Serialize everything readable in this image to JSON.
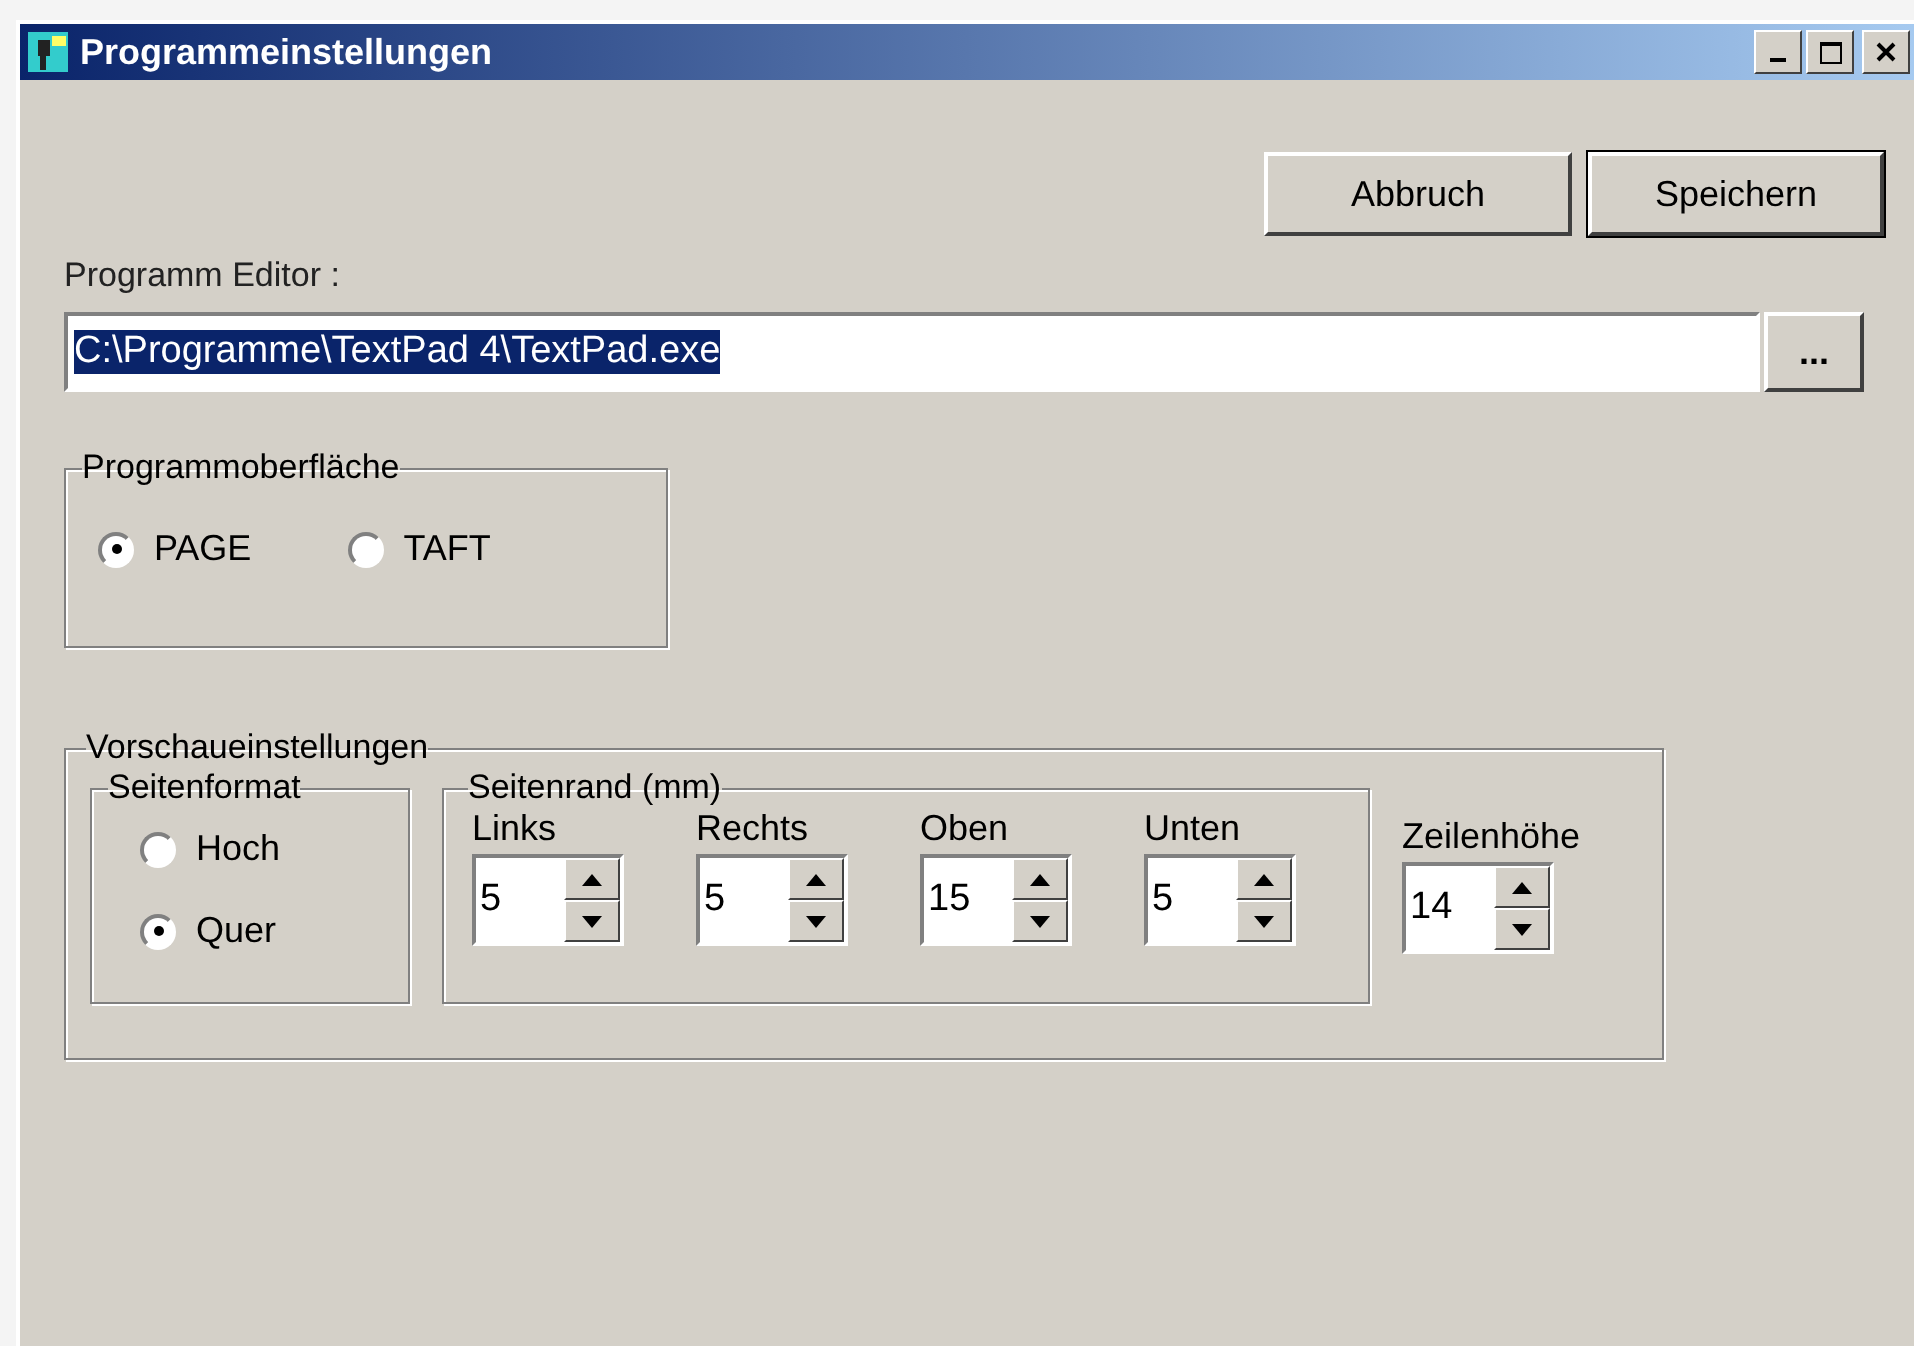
{
  "window": {
    "title": "Programmeinstellungen"
  },
  "buttons": [
    {
      "label": "Abbruch",
      "default": false
    },
    {
      "label": "Speichern",
      "default": true
    }
  ],
  "editor": {
    "label": "Programm Editor :",
    "value": "C:\\Programme\\TextPad 4\\TextPad.exe",
    "highlighted": true,
    "browse": "..."
  },
  "interface_group": {
    "title": "Programmoberfläche",
    "options": [
      {
        "label": "PAGE",
        "selected": true
      },
      {
        "label": "TAFT",
        "selected": false
      }
    ]
  },
  "preview_group": {
    "title": "Vorschaueinstellungen",
    "page_format": {
      "title": "Seitenformat",
      "options": [
        {
          "label": "Hoch",
          "selected": false
        },
        {
          "label": "Quer",
          "selected": true
        }
      ]
    },
    "margins": {
      "title": "Seitenrand (mm)",
      "fields": [
        {
          "label": "Links",
          "value": "5"
        },
        {
          "label": "Rechts",
          "value": "5"
        },
        {
          "label": "Oben",
          "value": "15"
        },
        {
          "label": "Unten",
          "value": "5"
        }
      ]
    },
    "line_height": {
      "label": "Zeilenhöhe",
      "value": "14"
    }
  }
}
